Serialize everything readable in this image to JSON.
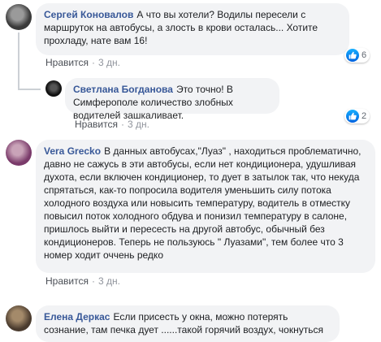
{
  "comments": [
    {
      "author": "Сергей Коновалов",
      "text": "А что вы хотели? Водилы пересели с маршруток на автобусы, а злость в крови осталась... Хотите прохладу, нате вам 16!",
      "like_label": "Нравится",
      "time": "3 дн.",
      "reaction_count": "6",
      "avatar_colors": [
        "#3a3a3a",
        "#9a9a9a"
      ]
    },
    {
      "author": "Светлана Богданова",
      "text": "Это точно! В Симферополе количество злобных водителей зашкаливает.",
      "like_label": "Нравится",
      "time": "3 дн.",
      "reaction_count": "2",
      "avatar_colors": [
        "#111111",
        "#555555"
      ]
    },
    {
      "author": "Vera Grecko",
      "text": "В данных автобусах,\"Луаз\" , находиться проблематично, давно не сажусь в эти автобусы, если нет кондиционера, удушливая духота, если включен кондиционер, то дует в затылок так, что некуда спрятаться, как-то попросила водителя уменьшить силу потока холодного воздуха или новысить температуру, водитель в отместку повысил поток холодного обдува и понизил температуру в салоне, пришлось выйти и пересесть на другой автобус, обычный без кондиционеров. Теперь не пользуюсь \" Луазами\", тем более что 3 номер ходит оччень редко",
      "like_label": "Нравится",
      "time": "3 дн.",
      "avatar_colors": [
        "#7a3a6a",
        "#c9a3b8"
      ]
    },
    {
      "author": "Елена Деркас",
      "text": "Если присесть у окна, можно потерять сознание, там печка дует ......такой горячий воздух, чокнуться",
      "avatar_colors": [
        "#4a3b2e",
        "#a48a6a"
      ]
    }
  ],
  "colors": {
    "author": "#385898",
    "bubble": "#f2f3f5",
    "like_badge": "#1877f2",
    "meta": "#90949c"
  }
}
